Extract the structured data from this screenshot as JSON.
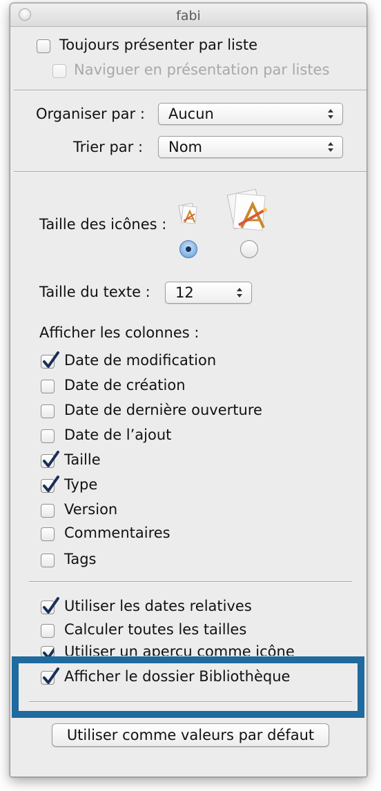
{
  "window": {
    "title": "fabi"
  },
  "general": {
    "always_list": {
      "label": "Toujours présenter par liste",
      "checked": false
    },
    "browse_list": {
      "label": "Naviguer en présentation par listes",
      "checked": false,
      "disabled": true
    }
  },
  "arrange": {
    "label": "Organiser par :",
    "value": "Aucun",
    "sort_label": "Trier par :",
    "sort_value": "Nom"
  },
  "icon_size": {
    "label": "Taille des icônes :",
    "selected": "small"
  },
  "text_size": {
    "label": "Taille du texte :",
    "value": "12"
  },
  "columns": {
    "label": "Afficher les colonnes :",
    "items": [
      {
        "label": "Date de modification",
        "checked": true
      },
      {
        "label": "Date de création",
        "checked": false
      },
      {
        "label": "Date de dernière ouverture",
        "checked": false
      },
      {
        "label": "Date de l’ajout",
        "checked": false
      },
      {
        "label": "Taille",
        "checked": true
      },
      {
        "label": "Type",
        "checked": true
      },
      {
        "label": "Version",
        "checked": false
      },
      {
        "label": "Commentaires",
        "checked": false
      },
      {
        "label": "Tags",
        "checked": false
      }
    ]
  },
  "options": {
    "items": [
      {
        "label": "Utiliser les dates relatives",
        "checked": true
      },
      {
        "label": "Calculer toutes les tailles",
        "checked": false
      },
      {
        "label": "Utiliser un aperçu comme icône",
        "checked": true
      },
      {
        "label": "Afficher le dossier Bibliothèque",
        "checked": true
      }
    ]
  },
  "footer": {
    "default_button": "Utiliser comme valeurs par défaut"
  },
  "colors": {
    "highlight_border": "#1f6a9e",
    "window_bg": "#ececec"
  }
}
